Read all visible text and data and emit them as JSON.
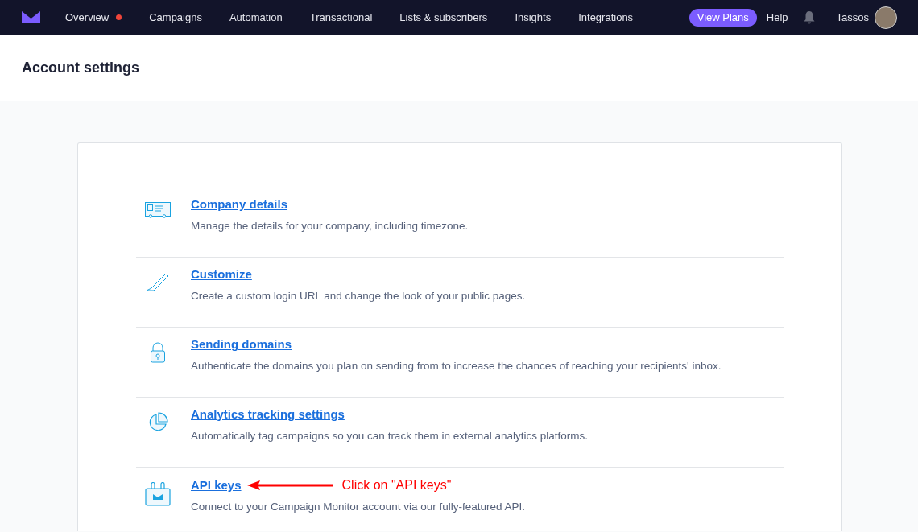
{
  "nav": {
    "items": [
      {
        "label": "Overview",
        "dot": true
      },
      {
        "label": "Campaigns",
        "dot": false
      },
      {
        "label": "Automation",
        "dot": false
      },
      {
        "label": "Transactional",
        "dot": false
      },
      {
        "label": "Lists & subscribers",
        "dot": false
      },
      {
        "label": "Insights",
        "dot": false
      },
      {
        "label": "Integrations",
        "dot": false
      }
    ],
    "plans_button": "View Plans",
    "help": "Help",
    "user": "Tassos"
  },
  "page_title": "Account settings",
  "settings": [
    {
      "kind": "card",
      "title": "Company details",
      "description": "Manage the details for your company, including timezone."
    },
    {
      "kind": "pencil",
      "title": "Customize",
      "description": "Create a custom login URL and change the look of your public pages."
    },
    {
      "kind": "lock",
      "title": "Sending domains",
      "description": "Authenticate the domains you plan on sending from to increase the chances of reaching your recipients' inbox."
    },
    {
      "kind": "pie",
      "title": "Analytics tracking settings",
      "description": "Automatically tag campaigns so you can track them in external analytics platforms."
    },
    {
      "kind": "key",
      "title": "API keys",
      "description": "Connect to your Campaign Monitor account via our fully-featured API.",
      "annotation": "Click on \"API keys\""
    }
  ]
}
